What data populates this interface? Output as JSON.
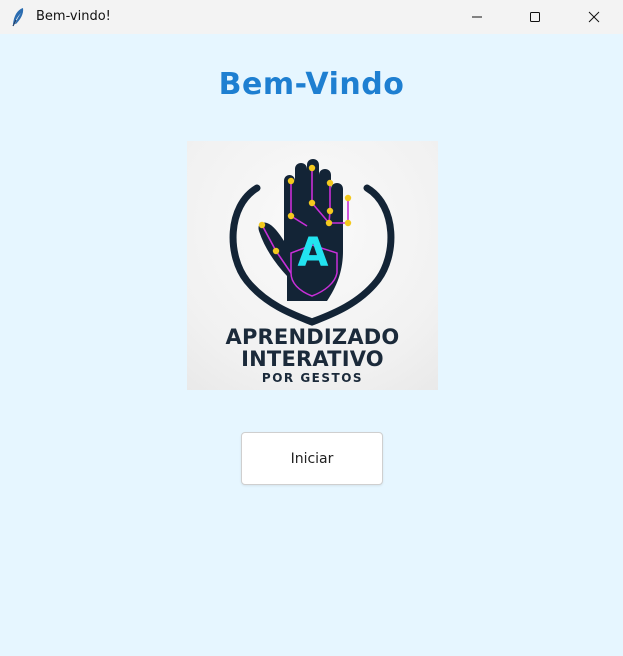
{
  "window": {
    "title": "Bem-vindo!",
    "app_icon": "feather-icon",
    "controls": [
      "minimize-icon",
      "maximize-icon",
      "close-icon"
    ]
  },
  "main": {
    "heading": "Bem-Vindo",
    "logo": {
      "letter": "A",
      "line1": "APRENDIZADO",
      "line2": "INTERATIVO",
      "line3": "POR GESTOS"
    },
    "start_button_label": "Iniciar"
  },
  "colors": {
    "background": "#e6f6ff",
    "heading": "#1e7fd1",
    "logo_navy": "#132436",
    "logo_cyan": "#22e3f0",
    "logo_magenta": "#c82fd8",
    "logo_yellow": "#f4c91e"
  }
}
